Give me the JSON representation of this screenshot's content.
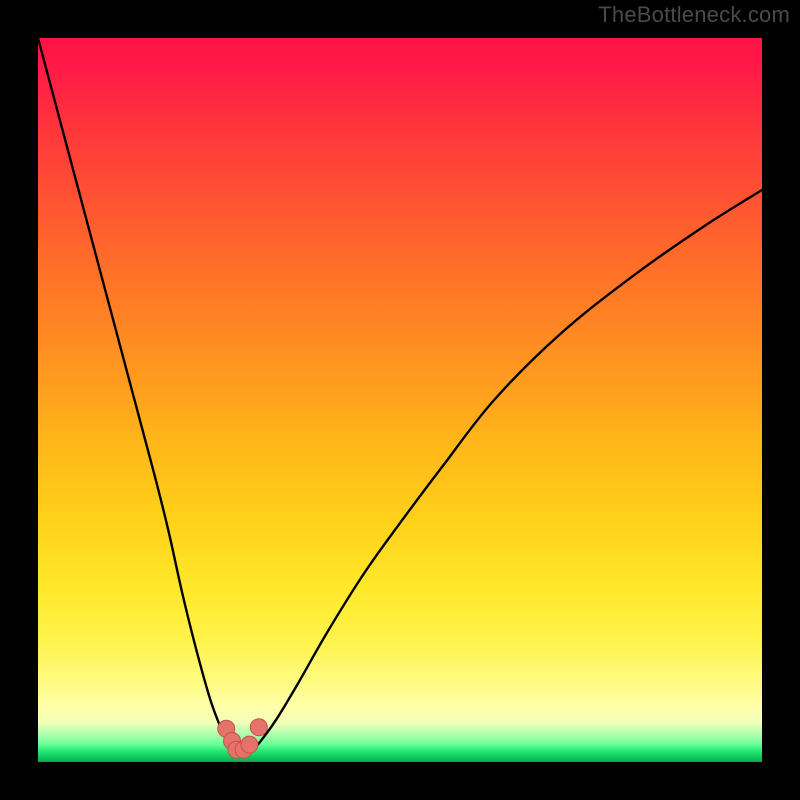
{
  "watermark": "TheBottleneck.com",
  "colors": {
    "frame": "#000000",
    "curve_stroke": "#000000",
    "marker_fill": "#e4736b",
    "marker_stroke": "#c95048",
    "gradient_top": "#ff1244",
    "gradient_bottom": "#0aa84f"
  },
  "chart_data": {
    "type": "line",
    "title": "",
    "xlabel": "",
    "ylabel": "",
    "xlim": [
      0,
      100
    ],
    "ylim": [
      0,
      100
    ],
    "series": [
      {
        "name": "bottleneck-curve",
        "x": [
          0,
          4,
          8,
          12,
          16,
          18,
          20,
          22,
          24,
          26,
          27,
          27.5,
          28.5,
          29.5,
          31,
          33,
          36,
          40,
          45,
          50,
          56,
          63,
          72,
          82,
          92,
          100
        ],
        "values": [
          100,
          85,
          70,
          55,
          40,
          32,
          23,
          15,
          8,
          3,
          1.2,
          0.8,
          0.8,
          1.4,
          3.2,
          6,
          11,
          18,
          26,
          33,
          41,
          50,
          59,
          67,
          74,
          79
        ]
      }
    ],
    "markers": [
      {
        "x": 26.0,
        "y": 4.6
      },
      {
        "x": 26.8,
        "y": 2.9
      },
      {
        "x": 27.4,
        "y": 1.7
      },
      {
        "x": 28.4,
        "y": 1.7
      },
      {
        "x": 29.2,
        "y": 2.4
      },
      {
        "x": 30.5,
        "y": 4.8
      }
    ],
    "legend": false,
    "grid": false
  }
}
